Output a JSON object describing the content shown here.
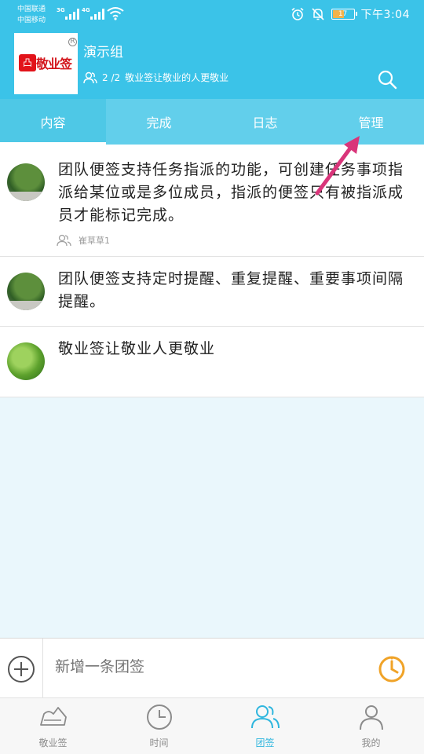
{
  "status_bar": {
    "carrier_1": "中国联通",
    "carrier_2": "中国移动",
    "net_1": "3G",
    "net_2": "4G",
    "battery": "17",
    "time": "下午3:04"
  },
  "header": {
    "logo_text": "敬业签",
    "group_name": "演示组",
    "member_count": "2 /2",
    "slogan": "敬业签让敬业的人更敬业"
  },
  "tabs": [
    {
      "label": "内容",
      "active": true
    },
    {
      "label": "完成",
      "active": false
    },
    {
      "label": "日志",
      "active": false
    },
    {
      "label": "管理",
      "active": false
    }
  ],
  "notes": [
    {
      "text": "团队便签支持任务指派的功能，可创建任务事项指派给某位或是多位成员，指派的便签只有被指派成员才能标记完成。",
      "assignee": "崔草草1"
    },
    {
      "text": "团队便签支持定时提醒、重复提醒、重要事项间隔提醒。"
    },
    {
      "text": "敬业签让敬业人更敬业"
    }
  ],
  "composer": {
    "placeholder": "新增一条团签"
  },
  "nav": [
    {
      "label": "敬业签",
      "icon": "cloud-note-icon",
      "active": false
    },
    {
      "label": "时间",
      "icon": "clock-icon",
      "active": false
    },
    {
      "label": "团签",
      "icon": "team-icon",
      "active": true
    },
    {
      "label": "我的",
      "icon": "person-icon",
      "active": false
    }
  ],
  "colors": {
    "header_bg": "#3bc3e8",
    "tab_bg": "#62cfeb",
    "accent": "#2fb6de",
    "timer": "#f0a328",
    "annotation": "#d9357a"
  }
}
